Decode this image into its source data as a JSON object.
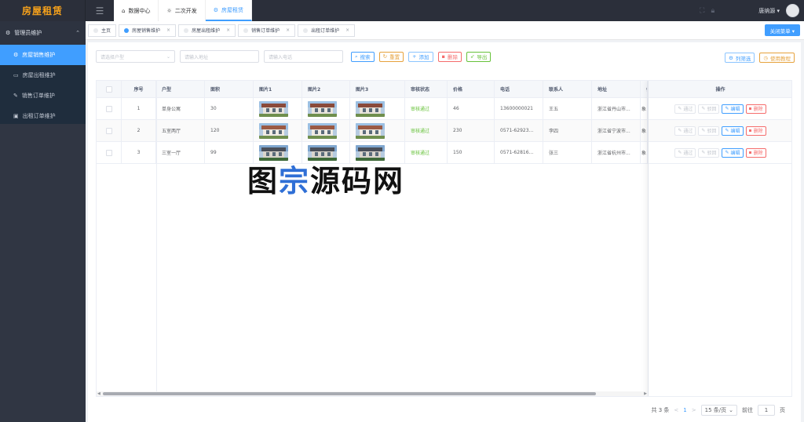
{
  "app": {
    "logo": "房屋租赁"
  },
  "topnav": [
    {
      "icon": "⌂",
      "label": "数据中心"
    },
    {
      "icon": "☼",
      "label": "二次开发"
    },
    {
      "icon": "⚙",
      "label": "房屋租赁"
    }
  ],
  "user": {
    "name": "唐纳源",
    "caret": "▾"
  },
  "sidebar": {
    "head": "管理员维护",
    "items": [
      {
        "label": "房屋销售维护"
      },
      {
        "label": "房屋出租维护"
      },
      {
        "label": "销售订单维护"
      },
      {
        "label": "出租订单维护"
      }
    ]
  },
  "tabs": [
    {
      "label": "主页",
      "close": ""
    },
    {
      "label": "房屋销售维护",
      "close": "×"
    },
    {
      "label": "房屋出租维护",
      "close": "×"
    },
    {
      "label": "销售订单维护",
      "close": "×"
    },
    {
      "label": "出租订单维护",
      "close": "×"
    }
  ],
  "close_menu": "关闭菜单 ▾",
  "toolbar": {
    "type_placeholder": "请选择户型",
    "address_placeholder": "请输入地址",
    "phone_placeholder": "请输入电话",
    "search": "搜索",
    "reset": "重置",
    "add": "添加",
    "delete": "删除",
    "export": "导出",
    "filter": "列筛选",
    "tutorial": "使用教程"
  },
  "table": {
    "headers": [
      "序号",
      "户型",
      "面积",
      "图片1",
      "图片2",
      "图片3",
      "审核状态",
      "价格",
      "电话",
      "联系人",
      "地址",
      "备",
      "操作"
    ],
    "rows": [
      {
        "no": "1",
        "type": "单身公寓",
        "area": "30",
        "status": "审核通过",
        "price": "46",
        "phone": "13600000021",
        "contact": "王五",
        "address": "浙江省丹山市...",
        "extra": "象"
      },
      {
        "no": "2",
        "type": "五室两厅",
        "area": "120",
        "status": "审核通过",
        "price": "230",
        "phone": "0571-62923...",
        "contact": "李四",
        "address": "浙江省宁波市...",
        "extra": "象"
      },
      {
        "no": "3",
        "type": "三室一厅",
        "area": "99",
        "status": "审核通过",
        "price": "150",
        "phone": "0571-62816...",
        "contact": "张三",
        "address": "浙江省杭州市...",
        "extra": "象"
      }
    ],
    "ops": {
      "pass": "通过",
      "reject": "驳回",
      "edit": "编辑",
      "del": "删除"
    }
  },
  "watermark": {
    "a": "图",
    "b": "宗",
    "c": "源码网"
  },
  "pager": {
    "total": "共 3 条",
    "page": "1",
    "size": "15 条/页",
    "goto": "前往",
    "goto_page": "1",
    "unit": "页",
    "prev": "<",
    "next": ">"
  }
}
